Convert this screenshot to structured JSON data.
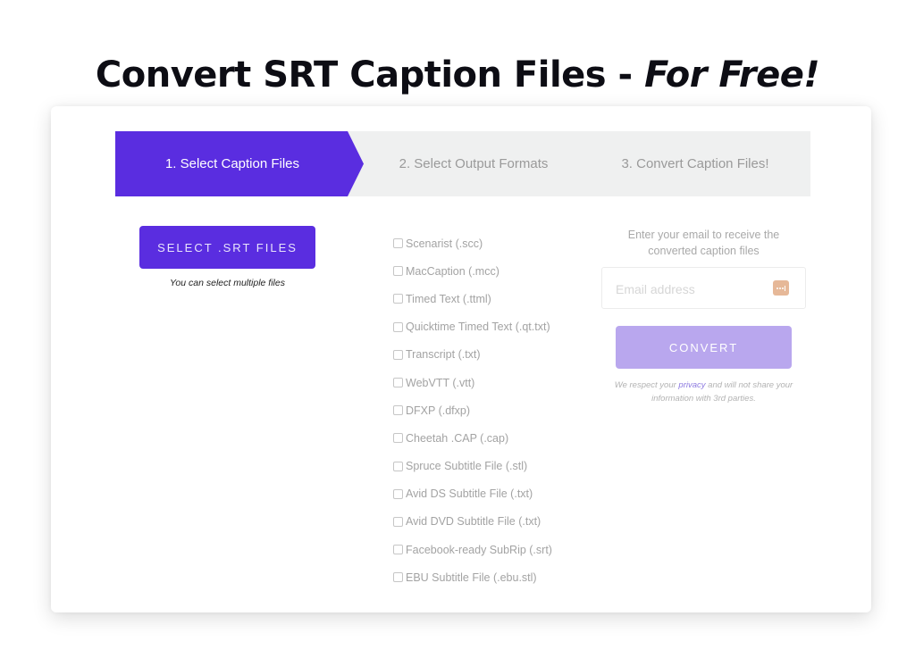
{
  "header": {
    "title_main": "Convert SRT Caption Files - ",
    "title_emphasis": "For Free!"
  },
  "steps": [
    {
      "label": "1. Select Caption Files",
      "active": true
    },
    {
      "label": "2. Select Output Formats",
      "active": false
    },
    {
      "label": "3. Convert Caption Files!",
      "active": false
    }
  ],
  "upload": {
    "button_label": "SELECT .SRT FILES",
    "hint": "You can select multiple files"
  },
  "formats": [
    {
      "label": "Scenarist (.scc)",
      "checked": false
    },
    {
      "label": "MacCaption (.mcc)",
      "checked": false
    },
    {
      "label": "Timed Text (.ttml)",
      "checked": false
    },
    {
      "label": "Quicktime Timed Text (.qt.txt)",
      "checked": false
    },
    {
      "label": "Transcript (.txt)",
      "checked": false
    },
    {
      "label": "WebVTT (.vtt)",
      "checked": false
    },
    {
      "label": "DFXP (.dfxp)",
      "checked": false
    },
    {
      "label": "Cheetah .CAP (.cap)",
      "checked": false
    },
    {
      "label": "Spruce Subtitle File (.stl)",
      "checked": false
    },
    {
      "label": "Avid DS Subtitle File (.txt)",
      "checked": false
    },
    {
      "label": "Avid DVD Subtitle File (.txt)",
      "checked": false
    },
    {
      "label": "Facebook-ready SubRip (.srt)",
      "checked": false
    },
    {
      "label": "EBU Subtitle File (.ebu.stl)",
      "checked": false
    }
  ],
  "email": {
    "instructions": "Enter your email to receive the converted caption files",
    "placeholder": "Email address",
    "value": "",
    "autofill_icon": "password-manager-dots-icon"
  },
  "convert": {
    "button_label": "CONVERT",
    "privacy_before": "We respect your ",
    "privacy_link": "privacy",
    "privacy_after": " and will not share your information with 3rd parties."
  },
  "colors": {
    "accent": "#5a2de0",
    "accent_disabled": "#b9a7ee",
    "step_inactive_bg": "#eff0f0"
  }
}
